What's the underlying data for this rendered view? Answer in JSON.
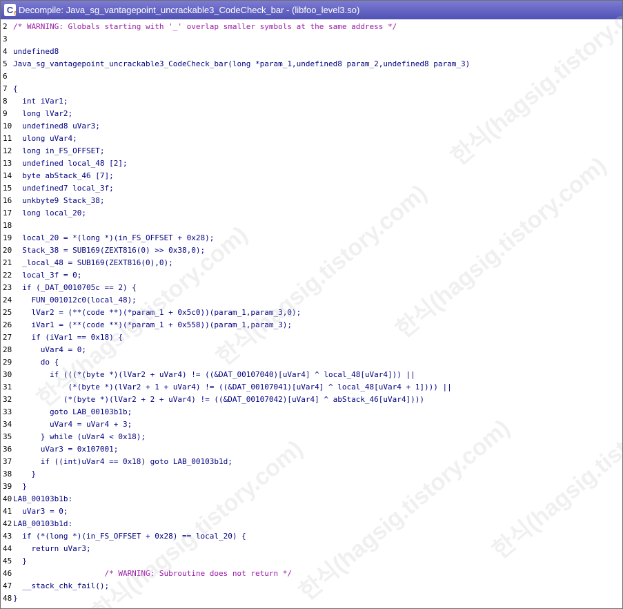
{
  "window": {
    "title": "Decompile: Java_sg_vantagepoint_uncrackable3_CodeCheck_bar -  (libfoo_level3.so)",
    "icon_glyph": "C",
    "icon_sub": "f"
  },
  "code": [
    {
      "n": "2",
      "t": "/* WARNING: Globals starting with '_' overlap smaller symbols at the same address */"
    },
    {
      "n": "3",
      "t": ""
    },
    {
      "n": "4",
      "t": "undefined8"
    },
    {
      "n": "5",
      "t": "Java_sg_vantagepoint_uncrackable3_CodeCheck_bar(long *param_1,undefined8 param_2,undefined8 param_3)"
    },
    {
      "n": "6",
      "t": ""
    },
    {
      "n": "7",
      "t": "{"
    },
    {
      "n": "8",
      "t": "  int iVar1;"
    },
    {
      "n": "9",
      "t": "  long lVar2;"
    },
    {
      "n": "10",
      "t": "  undefined8 uVar3;"
    },
    {
      "n": "11",
      "t": "  ulong uVar4;"
    },
    {
      "n": "12",
      "t": "  long in_FS_OFFSET;"
    },
    {
      "n": "13",
      "t": "  undefined local_48 [2];"
    },
    {
      "n": "14",
      "t": "  byte abStack_46 [7];"
    },
    {
      "n": "15",
      "t": "  undefined7 local_3f;"
    },
    {
      "n": "16",
      "t": "  unkbyte9 Stack_38;"
    },
    {
      "n": "17",
      "t": "  long local_20;"
    },
    {
      "n": "18",
      "t": ""
    },
    {
      "n": "19",
      "t": "  local_20 = *(long *)(in_FS_OFFSET + 0x28);"
    },
    {
      "n": "20",
      "t": "  Stack_38 = SUB169(ZEXT816(0) >> 0x38,0);"
    },
    {
      "n": "21",
      "t": "  _local_48 = SUB169(ZEXT816(0),0);"
    },
    {
      "n": "22",
      "t": "  local_3f = 0;"
    },
    {
      "n": "23",
      "t": "  if (_DAT_0010705c == 2) {"
    },
    {
      "n": "24",
      "t": "    FUN_001012c0(local_48);"
    },
    {
      "n": "25",
      "t": "    lVar2 = (**(code **)(*param_1 + 0x5c0))(param_1,param_3,0);"
    },
    {
      "n": "26",
      "t": "    iVar1 = (**(code **)(*param_1 + 0x558))(param_1,param_3);"
    },
    {
      "n": "27",
      "t": "    if (iVar1 == 0x18) {"
    },
    {
      "n": "28",
      "t": "      uVar4 = 0;"
    },
    {
      "n": "29",
      "t": "      do {"
    },
    {
      "n": "30",
      "t": "        if (((*(byte *)(lVar2 + uVar4) != ((&DAT_00107040)[uVar4] ^ local_48[uVar4])) ||"
    },
    {
      "n": "31",
      "t": "            (*(byte *)(lVar2 + 1 + uVar4) != ((&DAT_00107041)[uVar4] ^ local_48[uVar4 + 1]))) ||"
    },
    {
      "n": "32",
      "t": "           (*(byte *)(lVar2 + 2 + uVar4) != ((&DAT_00107042)[uVar4] ^ abStack_46[uVar4])))"
    },
    {
      "n": "33",
      "t": "        goto LAB_00103b1b;"
    },
    {
      "n": "34",
      "t": "        uVar4 = uVar4 + 3;"
    },
    {
      "n": "35",
      "t": "      } while (uVar4 < 0x18);"
    },
    {
      "n": "36",
      "t": "      uVar3 = 0x107001;"
    },
    {
      "n": "37",
      "t": "      if ((int)uVar4 == 0x18) goto LAB_00103b1d;"
    },
    {
      "n": "38",
      "t": "    }"
    },
    {
      "n": "39",
      "t": "  }"
    },
    {
      "n": "40",
      "t": "LAB_00103b1b:"
    },
    {
      "n": "41",
      "t": "  uVar3 = 0;"
    },
    {
      "n": "42",
      "t": "LAB_00103b1d:"
    },
    {
      "n": "43",
      "t": "  if (*(long *)(in_FS_OFFSET + 0x28) == local_20) {"
    },
    {
      "n": "44",
      "t": "    return uVar3;"
    },
    {
      "n": "45",
      "t": "  }"
    },
    {
      "n": "46",
      "t": "                    /* WARNING: Subroutine does not return */"
    },
    {
      "n": "47",
      "t": "  __stack_chk_fail();"
    },
    {
      "n": "48",
      "t": "}"
    }
  ],
  "watermark": {
    "text": "한식(hagsig.tistory.com)"
  }
}
